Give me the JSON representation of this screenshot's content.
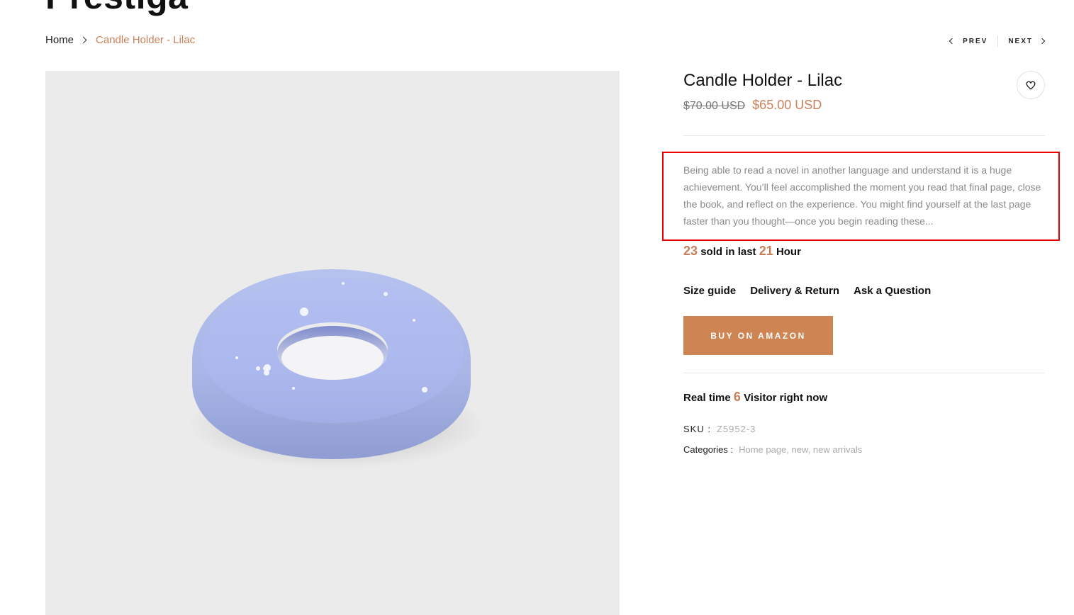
{
  "header": {
    "site_title": "Prestiga"
  },
  "breadcrumb": {
    "home": "Home",
    "current": "Candle Holder - Lilac"
  },
  "nav": {
    "prev": "PREV",
    "next": "NEXT"
  },
  "product": {
    "title": "Candle Holder - Lilac",
    "old_price": "$70.00 USD",
    "new_price": "$65.00 USD",
    "description": "Being able to read a novel in another language and understand it is a huge achievement. You’ll feel accomplished the moment you read that final page, close the book, and reflect on the experience. You might find yourself at the last page faster than you thought—once you begin reading these...",
    "sold_count": "23",
    "sold_text_mid": "sold in last",
    "sold_hours": "21",
    "sold_text_end": "Hour",
    "links": [
      "Size guide",
      "Delivery & Return",
      "Ask a Question"
    ],
    "buy_button": "BUY ON AMAZON",
    "visitors_prefix": "Real time",
    "visitors_count": "6",
    "visitors_suffix": "Visitor right now",
    "sku_label": "SKU :",
    "sku_value": "Z5952-3",
    "categories_label": "Categories :",
    "categories_value": "Home page, new, new arrivals"
  },
  "colors": {
    "accent": "#c9805a",
    "button": "#cf8553",
    "highlight_box": "#ee0000"
  },
  "icons": {
    "wishlist": "heart-icon",
    "prev": "chevron-left-icon",
    "next": "chevron-right-icon",
    "breadcrumb_sep": "chevron-right-icon"
  }
}
